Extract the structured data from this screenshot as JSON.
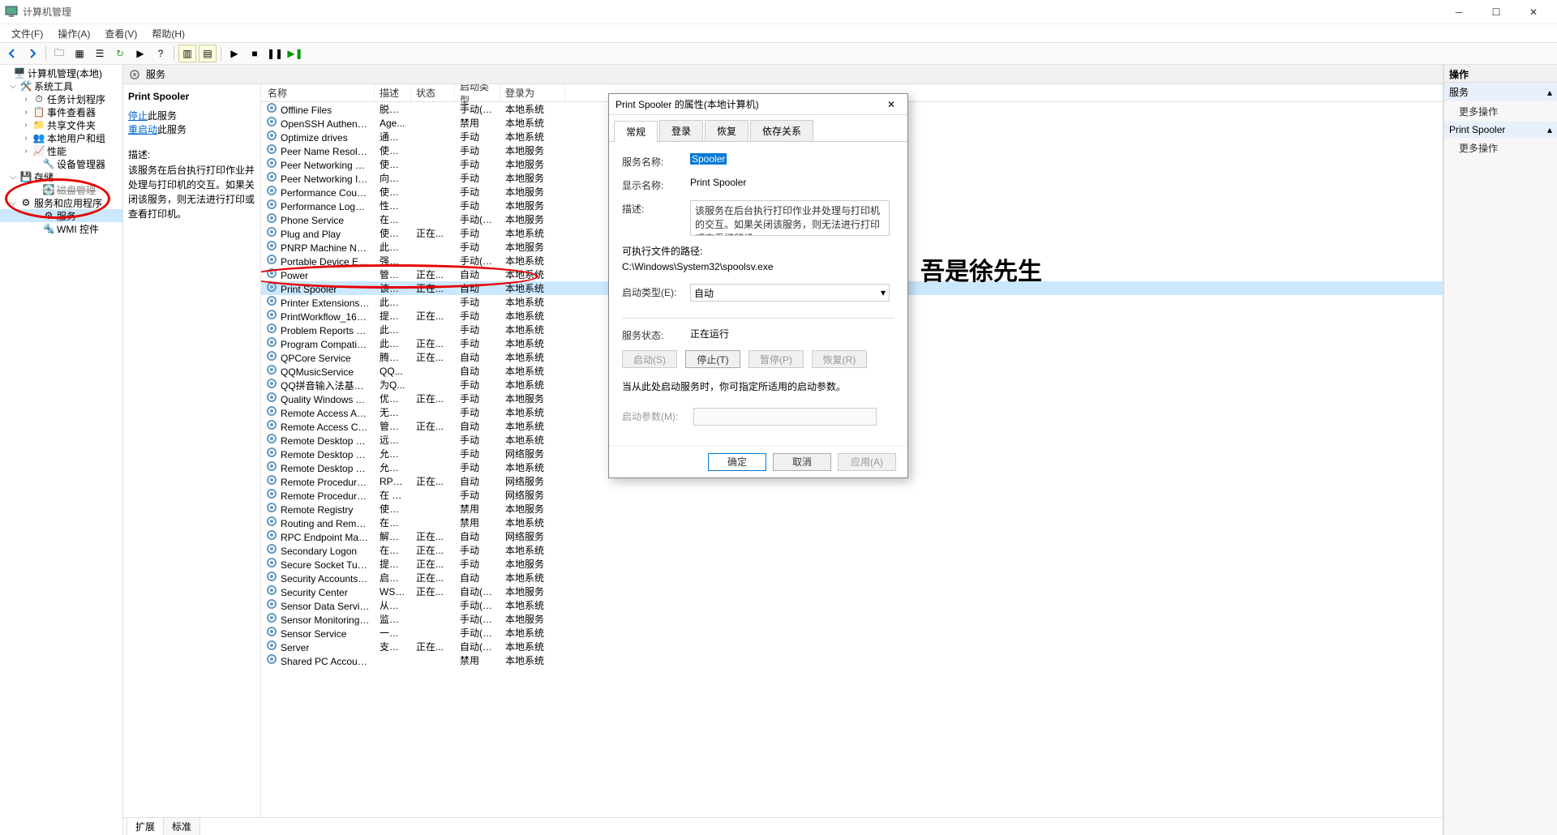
{
  "titlebar": {
    "title": "计算机管理"
  },
  "menubar": {
    "file": "文件(F)",
    "action": "操作(A)",
    "view": "查看(V)",
    "help": "帮助(H)"
  },
  "tree": {
    "root": "计算机管理(本地)",
    "sys_tools": "系统工具",
    "task_scheduler": "任务计划程序",
    "event_viewer": "事件查看器",
    "shared_folders": "共享文件夹",
    "local_users": "本地用户和组",
    "performance": "性能",
    "device_manager": "设备管理器",
    "storage": "存储",
    "disk_mgmt": "磁盘管理",
    "services_apps": "服务和应用程序",
    "services": "服务",
    "wmi": "WMI 控件"
  },
  "center": {
    "header": "服务",
    "selected_name": "Print Spooler",
    "stop_link_prefix": "停止",
    "stop_link_suffix": "此服务",
    "restart_link_prefix": "重启动",
    "restart_link_suffix": "此服务",
    "desc_label": "描述:",
    "desc_text": "该服务在后台执行打印作业并处理与打印机的交互。如果关闭该服务，则无法进行打印或查看打印机。"
  },
  "columns": {
    "name": "名称",
    "desc": "描述",
    "status": "状态",
    "startup": "启动类型",
    "logon": "登录为"
  },
  "services": [
    {
      "name": "Offline Files",
      "desc": "脱机...",
      "status": "",
      "startup": "手动(触发...",
      "logon": "本地系统"
    },
    {
      "name": "OpenSSH Authentication ...",
      "desc": "Age...",
      "status": "",
      "startup": "禁用",
      "logon": "本地系统"
    },
    {
      "name": "Optimize drives",
      "desc": "通过...",
      "status": "",
      "startup": "手动",
      "logon": "本地系统"
    },
    {
      "name": "Peer Name Resolution Pr...",
      "desc": "使用...",
      "status": "",
      "startup": "手动",
      "logon": "本地服务"
    },
    {
      "name": "Peer Networking Groupi...",
      "desc": "使用...",
      "status": "",
      "startup": "手动",
      "logon": "本地服务"
    },
    {
      "name": "Peer Networking Identity...",
      "desc": "向对...",
      "status": "",
      "startup": "手动",
      "logon": "本地服务"
    },
    {
      "name": "Performance Counter DL...",
      "desc": "使远...",
      "status": "",
      "startup": "手动",
      "logon": "本地服务"
    },
    {
      "name": "Performance Logs & Aler...",
      "desc": "性能...",
      "status": "",
      "startup": "手动",
      "logon": "本地服务"
    },
    {
      "name": "Phone Service",
      "desc": "在设...",
      "status": "",
      "startup": "手动(触发...",
      "logon": "本地服务"
    },
    {
      "name": "Plug and Play",
      "desc": "使计...",
      "status": "正在...",
      "startup": "手动",
      "logon": "本地系统"
    },
    {
      "name": "PNRP Machine Name Pu...",
      "desc": "此服...",
      "status": "",
      "startup": "手动",
      "logon": "本地服务"
    },
    {
      "name": "Portable Device Enumera...",
      "desc": "强制...",
      "status": "",
      "startup": "手动(触发...",
      "logon": "本地系统"
    },
    {
      "name": "Power",
      "desc": "管理...",
      "status": "正在...",
      "startup": "自动",
      "logon": "本地系统"
    },
    {
      "name": "Print Spooler",
      "desc": "该服...",
      "status": "正在...",
      "startup": "自动",
      "logon": "本地系统",
      "selected": true
    },
    {
      "name": "Printer Extensions and N...",
      "desc": "此服...",
      "status": "",
      "startup": "手动",
      "logon": "本地系统"
    },
    {
      "name": "PrintWorkflow_1634f480",
      "desc": "提供...",
      "status": "正在...",
      "startup": "手动",
      "logon": "本地系统"
    },
    {
      "name": "Problem Reports Control...",
      "desc": "此服...",
      "status": "",
      "startup": "手动",
      "logon": "本地系统"
    },
    {
      "name": "Program Compatibility A...",
      "desc": "此服...",
      "status": "正在...",
      "startup": "手动",
      "logon": "本地系统"
    },
    {
      "name": "QPCore Service",
      "desc": "腾讯...",
      "status": "正在...",
      "startup": "自动",
      "logon": "本地系统"
    },
    {
      "name": "QQMusicService",
      "desc": "QQ...",
      "status": "",
      "startup": "自动",
      "logon": "本地系统"
    },
    {
      "name": "QQ拼音输入法基础服务",
      "desc": "为Q...",
      "status": "",
      "startup": "手动",
      "logon": "本地系统"
    },
    {
      "name": "Quality Windows Audio V...",
      "desc": "优质...",
      "status": "正在...",
      "startup": "手动",
      "logon": "本地服务"
    },
    {
      "name": "Remote Access Auto Con...",
      "desc": "无论...",
      "status": "",
      "startup": "手动",
      "logon": "本地系统"
    },
    {
      "name": "Remote Access Connecti...",
      "desc": "管理...",
      "status": "正在...",
      "startup": "自动",
      "logon": "本地系统"
    },
    {
      "name": "Remote Desktop Configu...",
      "desc": "远程...",
      "status": "",
      "startup": "手动",
      "logon": "本地系统"
    },
    {
      "name": "Remote Desktop Services",
      "desc": "允许...",
      "status": "",
      "startup": "手动",
      "logon": "网络服务"
    },
    {
      "name": "Remote Desktop Service...",
      "desc": "允许...",
      "status": "",
      "startup": "手动",
      "logon": "本地系统"
    },
    {
      "name": "Remote Procedure Call (...",
      "desc": "RPC...",
      "status": "正在...",
      "startup": "自动",
      "logon": "网络服务"
    },
    {
      "name": "Remote Procedure Call (...",
      "desc": "在 W...",
      "status": "",
      "startup": "手动",
      "logon": "网络服务"
    },
    {
      "name": "Remote Registry",
      "desc": "使远...",
      "status": "",
      "startup": "禁用",
      "logon": "本地服务"
    },
    {
      "name": "Routing and Remote Acc...",
      "desc": "在局...",
      "status": "",
      "startup": "禁用",
      "logon": "本地系统"
    },
    {
      "name": "RPC Endpoint Mapper",
      "desc": "解析 ...",
      "status": "正在...",
      "startup": "自动",
      "logon": "网络服务"
    },
    {
      "name": "Secondary Logon",
      "desc": "在不...",
      "status": "正在...",
      "startup": "手动",
      "logon": "本地系统"
    },
    {
      "name": "Secure Socket Tunneling ...",
      "desc": "提供...",
      "status": "正在...",
      "startup": "手动",
      "logon": "本地服务"
    },
    {
      "name": "Security Accounts Manag...",
      "desc": "启动...",
      "status": "正在...",
      "startup": "自动",
      "logon": "本地系统"
    },
    {
      "name": "Security Center",
      "desc": "WSC...",
      "status": "正在...",
      "startup": "自动(延迟...",
      "logon": "本地服务"
    },
    {
      "name": "Sensor Data Service",
      "desc": "从各...",
      "status": "",
      "startup": "手动(触发...",
      "logon": "本地系统"
    },
    {
      "name": "Sensor Monitoring Service",
      "desc": "监视...",
      "status": "",
      "startup": "手动(触发...",
      "logon": "本地服务"
    },
    {
      "name": "Sensor Service",
      "desc": "一项...",
      "status": "",
      "startup": "手动(触发...",
      "logon": "本地系统"
    },
    {
      "name": "Server",
      "desc": "支持...",
      "status": "正在...",
      "startup": "自动(触发...",
      "logon": "本地系统"
    },
    {
      "name": "Shared PC Account Mana...",
      "desc": "",
      "status": "",
      "startup": "禁用",
      "logon": "本地系统"
    }
  ],
  "bottom_tabs": {
    "extended": "扩展",
    "standard": "标准"
  },
  "actions": {
    "title": "操作",
    "section1": "服务",
    "more1": "更多操作",
    "section2": "Print Spooler",
    "more2": "更多操作"
  },
  "dialog": {
    "title": "Print Spooler 的属性(本地计算机)",
    "tab_general": "常规",
    "tab_logon": "登录",
    "tab_recovery": "恢复",
    "tab_deps": "依存关系",
    "lbl_service_name": "服务名称:",
    "val_service_name": "Spooler",
    "lbl_display_name": "显示名称:",
    "val_display_name": "Print Spooler",
    "lbl_desc": "描述:",
    "val_desc": "该服务在后台执行打印作业并处理与打印机的交互。如果关闭该服务，则无法进行打印或查看打印机。",
    "lbl_path": "可执行文件的路径:",
    "val_path": "C:\\Windows\\System32\\spoolsv.exe",
    "lbl_startup": "启动类型(E):",
    "val_startup": "自动",
    "lbl_status": "服务状态:",
    "val_status": "正在运行",
    "btn_start": "启动(S)",
    "btn_stop": "停止(T)",
    "btn_pause": "暂停(P)",
    "btn_resume": "恢复(R)",
    "note": "当从此处启动服务时，你可指定所适用的启动参数。",
    "lbl_param": "启动参数(M):",
    "btn_ok": "确定",
    "btn_cancel": "取消",
    "btn_apply": "应用(A)"
  },
  "annotation": {
    "label": "吾是徐先生"
  }
}
